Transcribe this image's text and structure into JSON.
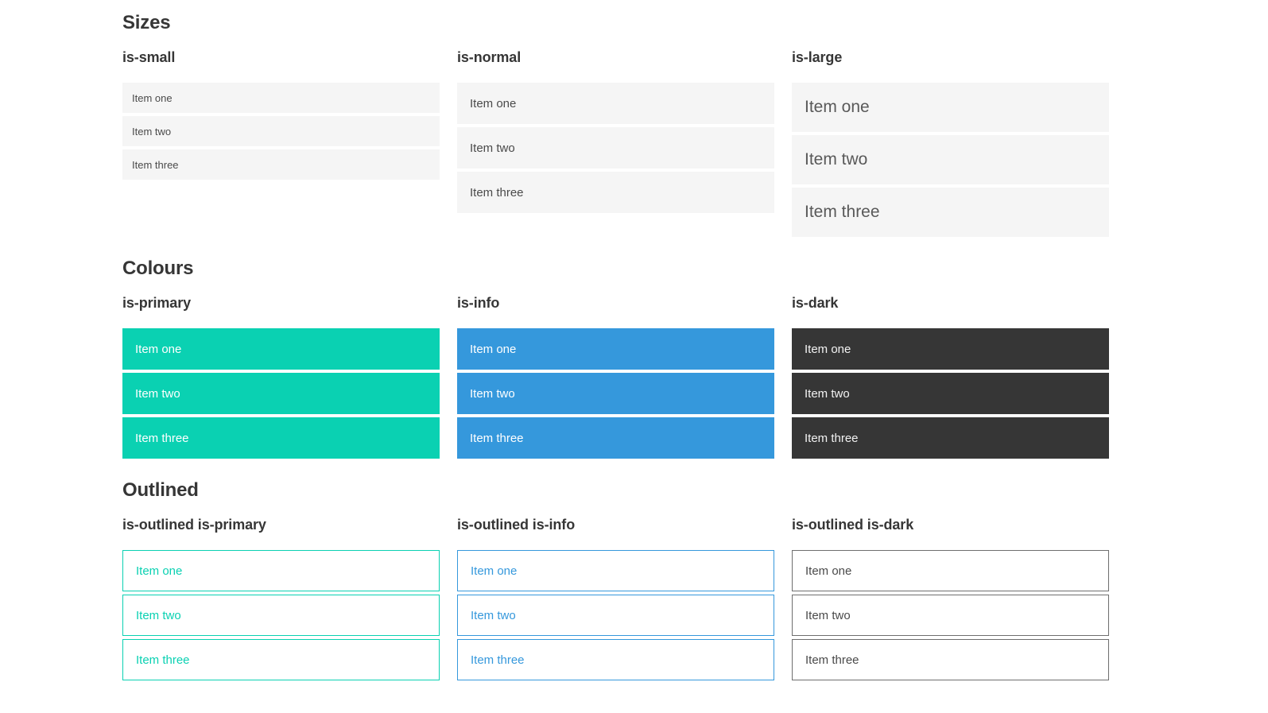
{
  "colors": {
    "primary": "#0ad1b2",
    "info": "#3598dc",
    "dark": "#363636",
    "item_bg": "#f5f5f5",
    "item_text": "#4a4a4a",
    "white": "#ffffff"
  },
  "sections": [
    {
      "title": "Sizes",
      "groups": [
        {
          "label": "is-small",
          "items": [
            "Item one",
            "Item two",
            "Item three"
          ]
        },
        {
          "label": "is-normal",
          "items": [
            "Item one",
            "Item two",
            "Item three"
          ]
        },
        {
          "label": "is-large",
          "items": [
            "Item one",
            "Item two",
            "Item three"
          ]
        }
      ]
    },
    {
      "title": "Colours",
      "groups": [
        {
          "label": "is-primary",
          "items": [
            "Item one",
            "Item two",
            "Item three"
          ]
        },
        {
          "label": "is-info",
          "items": [
            "Item one",
            "Item two",
            "Item three"
          ]
        },
        {
          "label": "is-dark",
          "items": [
            "Item one",
            "Item two",
            "Item three"
          ]
        }
      ]
    },
    {
      "title": "Outlined",
      "groups": [
        {
          "label": "is-outlined is-primary",
          "items": [
            "Item one",
            "Item two",
            "Item three"
          ]
        },
        {
          "label": "is-outlined is-info",
          "items": [
            "Item one",
            "Item two",
            "Item three"
          ]
        },
        {
          "label": "is-outlined is-dark",
          "items": [
            "Item one",
            "Item two",
            "Item three"
          ]
        }
      ]
    }
  ]
}
